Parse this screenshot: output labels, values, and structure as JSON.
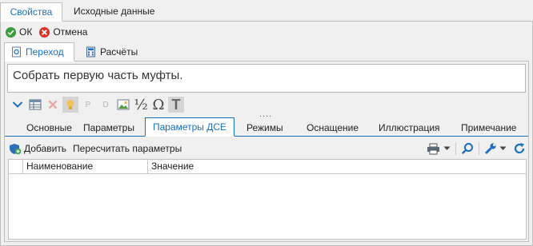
{
  "top_tabs": [
    "Свойства",
    "Исходные данные"
  ],
  "actions": {
    "ok": "ОК",
    "cancel": "Отмена"
  },
  "sub_tabs": [
    "Переход",
    "Расчёты"
  ],
  "text": "Собрать первую часть муфты.",
  "format_toolbar": {
    "half": "½",
    "omega": "Ω",
    "text_t": "T",
    "p": "P",
    "d": "D"
  },
  "dots": "....",
  "param_tabs": [
    "Основные",
    "Параметры",
    "Параметры ДСЕ",
    "Режимы",
    "Оснащение",
    "Иллюстрация",
    "Примечание"
  ],
  "grid_toolbar": {
    "add": "Добавить",
    "recalc": "Пересчитать параметры"
  },
  "grid": {
    "columns": [
      "Наименование",
      "Значение"
    ],
    "rows": []
  },
  "colors": {
    "accent": "#1a6fc0",
    "ok_green": "#3a9e3a",
    "cancel_red": "#d9342b"
  }
}
